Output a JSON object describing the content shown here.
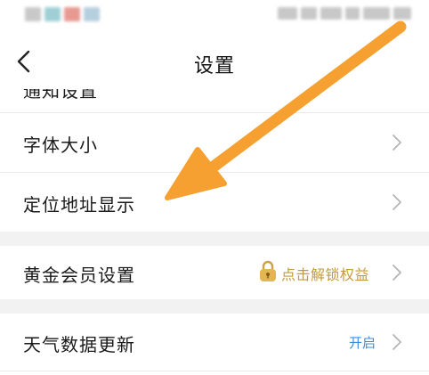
{
  "nav": {
    "title": "设置"
  },
  "settings": {
    "items": [
      {
        "label": "通知设置"
      },
      {
        "label": "字体大小"
      },
      {
        "label": "定位地址显示"
      },
      {
        "label": "黄金会员设置",
        "value": "点击解锁权益"
      },
      {
        "label": "天气数据更新",
        "value": "开启"
      }
    ]
  },
  "colors": {
    "accent_arrow": "#f5a030",
    "gold": "#c49a3a",
    "blue_status": "#3b8de0",
    "section_gap": "#f2f2f2"
  },
  "icons": {
    "back": "chevron-left-icon",
    "row_arrow": "chevron-right-icon",
    "lock": "lock-icon"
  }
}
